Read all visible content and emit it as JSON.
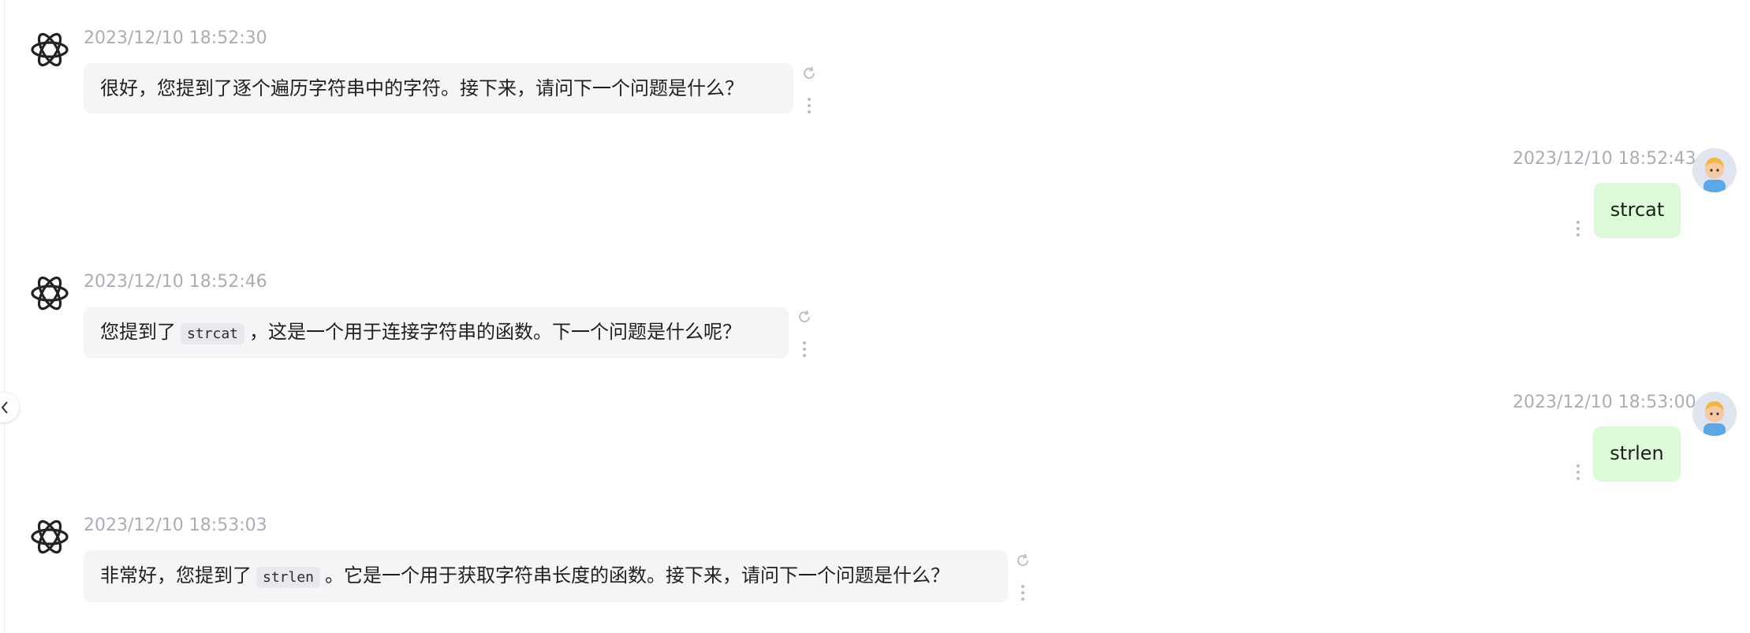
{
  "messages": [
    {
      "role": "assistant",
      "timestamp": "2023/12/10 18:52:30",
      "text": "很好，您提到了逐个遍历字符串中的字符。接下来，请问下一个问题是什么？"
    },
    {
      "role": "user",
      "timestamp": "2023/12/10 18:52:43",
      "text": "strcat"
    },
    {
      "role": "assistant",
      "timestamp": "2023/12/10 18:52:46",
      "text_before": "您提到了",
      "code": "strcat",
      "text_after": "，这是一个用于连接字符串的函数。下一个问题是什么呢？"
    },
    {
      "role": "user",
      "timestamp": "2023/12/10 18:53:00",
      "text": "strlen"
    },
    {
      "role": "assistant",
      "timestamp": "2023/12/10 18:53:03",
      "text_before": "非常好，您提到了",
      "code": "strlen",
      "text_after": "。它是一个用于获取字符串长度的函数。接下来，请问下一个问题是什么？"
    }
  ],
  "icons": {
    "assistant_avatar": "openai-logo-icon",
    "user_avatar": "cartoon-person-icon",
    "regenerate": "refresh-icon",
    "more": "more-vertical-icon",
    "collapse": "chevron-left-icon"
  },
  "colors": {
    "assistant_bubble": "#f4f5f7",
    "user_bubble": "#dcf9d8",
    "timestamp": "#a9adb5"
  }
}
